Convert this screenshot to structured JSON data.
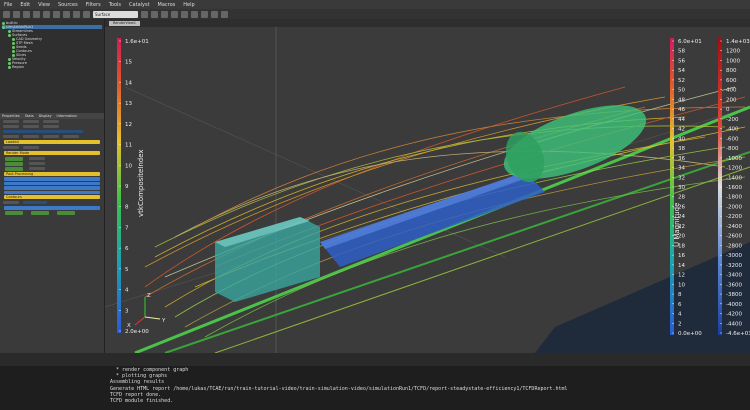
{
  "window": {
    "title": "ParaView"
  },
  "menubar": {
    "items": [
      "File",
      "Edit",
      "View",
      "Sources",
      "Filters",
      "Tools",
      "Catalyst",
      "Macros",
      "Help"
    ]
  },
  "toolbar": {
    "representation": "Surface"
  },
  "pipeline": {
    "items": [
      "builtin:",
      "simulationRun1",
      "Streamlines",
      "Surfaces",
      "CAD Geometry",
      "STP Mesh",
      "Seeds",
      "Contours",
      "Slices",
      "Velocity",
      "Pressure",
      "Region"
    ]
  },
  "properties": {
    "tabs": [
      "Properties",
      "Stats",
      "Display",
      "Information"
    ],
    "sections": [
      "Loaded",
      "Render Mode",
      "Post-Processing",
      "Contours",
      "Settings"
    ]
  },
  "viewport": {
    "tab_label": "RenderView1",
    "colorbar_left": {
      "title": "vtkCompositeIndex",
      "ticks": [
        "1.6e+01",
        "15",
        "14",
        "13",
        "12",
        "11",
        "10",
        "9",
        "8",
        "7",
        "6",
        "5",
        "4",
        "3",
        "2.0e+00"
      ]
    },
    "colorbar_mid": {
      "title": "U Magnitude",
      "ticks": [
        "6.0e+01",
        "58",
        "56",
        "54",
        "52",
        "50",
        "48",
        "46",
        "44",
        "42",
        "40",
        "38",
        "36",
        "34",
        "32",
        "30",
        "28",
        "26",
        "24",
        "22",
        "20",
        "18",
        "16",
        "14",
        "12",
        "10",
        "8",
        "6",
        "4",
        "2",
        "0.0e+00"
      ]
    },
    "colorbar_right": {
      "ticks": [
        "1.4e+03",
        "1200",
        "1000",
        "800",
        "600",
        "400",
        "200",
        "0",
        "-200",
        "-400",
        "-600",
        "-800",
        "-1000",
        "-1200",
        "-1400",
        "-1600",
        "-1800",
        "-2000",
        "-2200",
        "-2400",
        "-2600",
        "-2800",
        "-3000",
        "-3200",
        "-3400",
        "-3600",
        "-3800",
        "-4000",
        "-4200",
        "-4400",
        "-4.6e+03"
      ]
    },
    "axes": {
      "x": "X",
      "y": "Y",
      "z": "Z"
    }
  },
  "console": {
    "lines": [
      "  * render component graph",
      "  * plotting graphs",
      "Assembling results",
      "Generate HTML report /home/lukas/TCAE/run/train-tutorial-video/train-simulation-video/simulationRun1/TCFD/report-steadystate-efficiency1/TCFDReport.html",
      "TCFD report done.",
      "TCFD module finished."
    ]
  },
  "colors": {
    "accent_yellow": "#e4c12c",
    "accent_blue": "#3d79c7",
    "viewport_bg": "#3b3b3b"
  }
}
